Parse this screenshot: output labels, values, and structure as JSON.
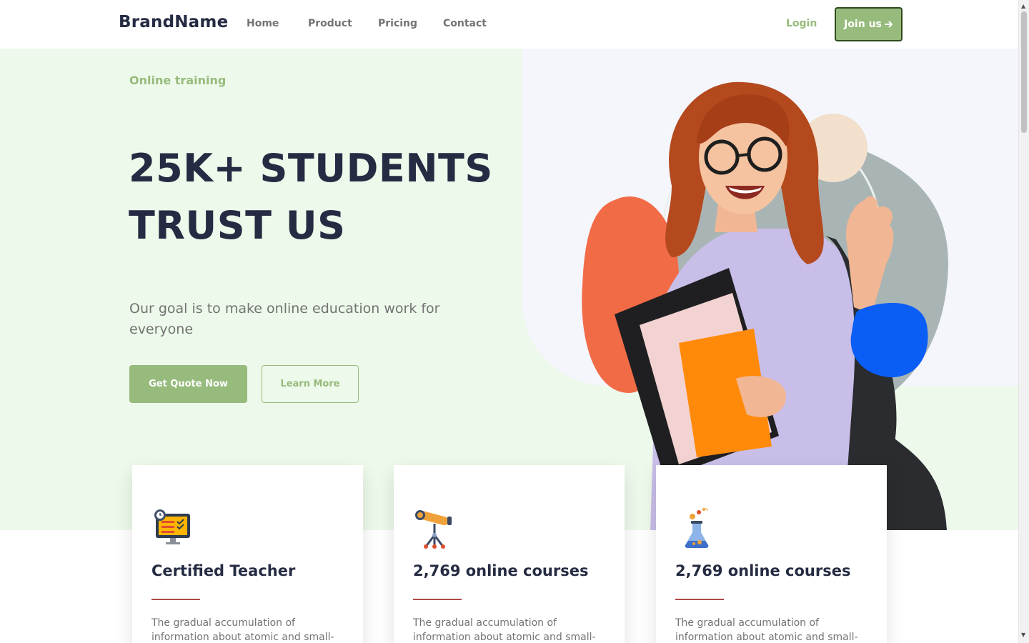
{
  "nav": {
    "brand": "BrandName",
    "links": [
      "Home",
      "Product",
      "Pricing",
      "Contact"
    ],
    "login": "Login",
    "join": "Join us",
    "join_icon": "arrow-right-icon"
  },
  "hero": {
    "kicker": "Online training",
    "title": "25K+ STUDENTS TRUST US",
    "subtitle": "Our goal is to make online education work for everyone",
    "primary_button": "Get Quote Now",
    "secondary_button": "Learn More"
  },
  "cards": [
    {
      "icon": "computer-checklist-icon",
      "title": "Certified Teacher",
      "text": "The gradual accumulation of information about atomic and small-"
    },
    {
      "icon": "telescope-icon",
      "title": "2,769 online courses",
      "text": "The gradual accumulation of information about atomic and small-"
    },
    {
      "icon": "flask-icon",
      "title": "2,769 online courses",
      "text": "The gradual accumulation of information about atomic and small-"
    }
  ],
  "colors": {
    "accent": "#96BB7C",
    "dark": "#252B42",
    "muted": "#737373",
    "hero_bg": "#EDF9EA",
    "rule": "#B2484A"
  }
}
